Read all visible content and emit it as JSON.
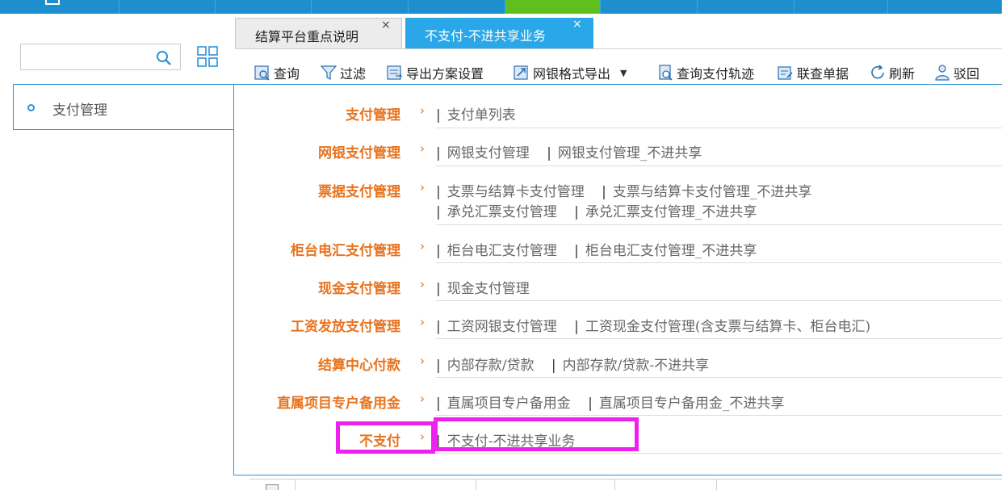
{
  "tabs": [
    {
      "label": "结算平台重点说明",
      "close": "×"
    },
    {
      "label": "不支付-不进共享业务",
      "close": "×"
    }
  ],
  "search": {
    "value": "",
    "placeholder": ""
  },
  "left_menu": {
    "label": "支付管理"
  },
  "toolbar": [
    {
      "label": "查询",
      "icon": "query-icon"
    },
    {
      "label": "过滤",
      "icon": "filter-icon"
    },
    {
      "label": "导出方案设置",
      "icon": "export-settings-icon"
    },
    {
      "label": "网银格式导出",
      "icon": "export-icon",
      "dropdown": "▼"
    },
    {
      "label": "查询支付轨迹",
      "icon": "track-icon"
    },
    {
      "label": "联查单据",
      "icon": "linked-docs-icon"
    },
    {
      "label": "刷新",
      "icon": "refresh-icon"
    },
    {
      "label": "驳回",
      "icon": "reject-icon"
    }
  ],
  "menu": {
    "chevron": "›",
    "rows": [
      {
        "category": "支付管理",
        "links": [
          "支付单列表"
        ]
      },
      {
        "category": "网银支付管理",
        "links": [
          "网银支付管理",
          "网银支付管理_不进共享"
        ]
      },
      {
        "category": "票据支付管理",
        "links": [
          "支票与结算卡支付管理",
          "支票与结算卡支付管理_不进共享"
        ],
        "links2": [
          "承兑汇票支付管理",
          "承兑汇票支付管理_不进共享"
        ]
      },
      {
        "category": "柜台电汇支付管理",
        "links": [
          "柜台电汇支付管理",
          "柜台电汇支付管理_不进共享"
        ]
      },
      {
        "category": "现金支付管理",
        "links": [
          "现金支付管理"
        ]
      },
      {
        "category": "工资发放支付管理",
        "links": [
          "工资网银支付管理",
          "工资现金支付管理(含支票与结算卡、柜台电汇)"
        ]
      },
      {
        "category": "结算中心付款",
        "links": [
          "内部存款/贷款",
          "内部存款/贷款-不进共享"
        ]
      },
      {
        "category": "直属项目专户备用金",
        "links": [
          "直属项目专户备用金",
          "直属项目专户备用金_不进共享"
        ]
      },
      {
        "category": "不支付",
        "links": [
          "不支付-不进共享业务"
        ]
      }
    ]
  },
  "colors": {
    "accent_blue": "#29a7e8",
    "category_orange": "#e8731d",
    "highlight_magenta": "#ee22ee",
    "nav_green": "#5fbf1c"
  }
}
